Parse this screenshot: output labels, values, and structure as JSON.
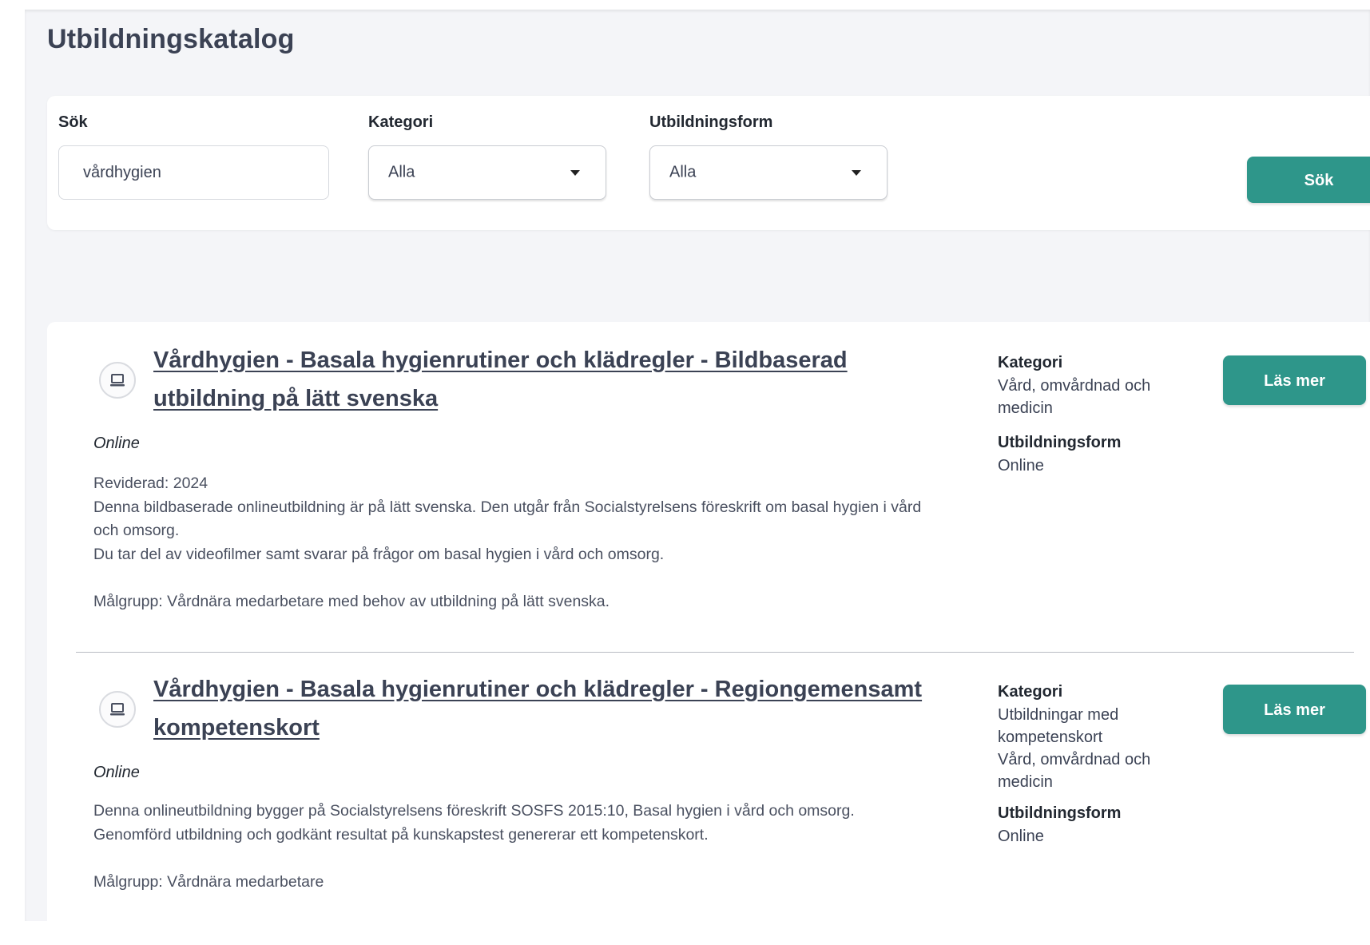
{
  "page": {
    "title": "Utbildningskatalog"
  },
  "search": {
    "query_label": "Sök",
    "query_value": "vårdhygien",
    "category_label": "Kategori",
    "category_value": "Alla",
    "format_label": "Utbildningsform",
    "format_value": "Alla",
    "submit_label": "Sök"
  },
  "results": [
    {
      "title": "Vårdhygien - Basala hygienrutiner och klädregler - Bildbaserad utbildning på lätt svenska",
      "format": "Online",
      "description": "Reviderad: 2024\nDenna bildbaserade onlineutbildning är på lätt svenska. Den utgår från Socialstyrelsens föreskrift om basal hygien i vård och omsorg.\nDu tar del av videofilmer samt svarar på frågor om basal hygien i vård och omsorg.\n\nMålgrupp: Vårdnära medarbetare med behov av utbildning på lätt svenska.",
      "category_label": "Kategori",
      "category_value": "Vård, omvårdnad och medicin",
      "format_label": "Utbildningsform",
      "format_value": "Online",
      "button_label": "Läs mer",
      "icon": "laptop-icon"
    },
    {
      "title": "Vårdhygien - Basala hygienrutiner och klädregler - Regiongemensamt kompetenskort",
      "format": "Online",
      "description": "Denna onlineutbildning bygger på Socialstyrelsens föreskrift SOSFS 2015:10, Basal hygien i vård och omsorg.\nGenomförd utbildning och godkänt resultat på kunskapstest genererar ett kompetenskort.\n\nMålgrupp: Vårdnära medarbetare",
      "category_label": "Kategori",
      "category_value": "Utbildningar med kompetenskort\nVård, omvårdnad och medicin",
      "format_label": "Utbildningsform",
      "format_value": "Online",
      "button_label": "Läs mer",
      "icon": "laptop-icon"
    }
  ],
  "colors": {
    "accent": "#2e968a",
    "page_background": "#f4f5f8",
    "title_text": "#3b4254"
  }
}
